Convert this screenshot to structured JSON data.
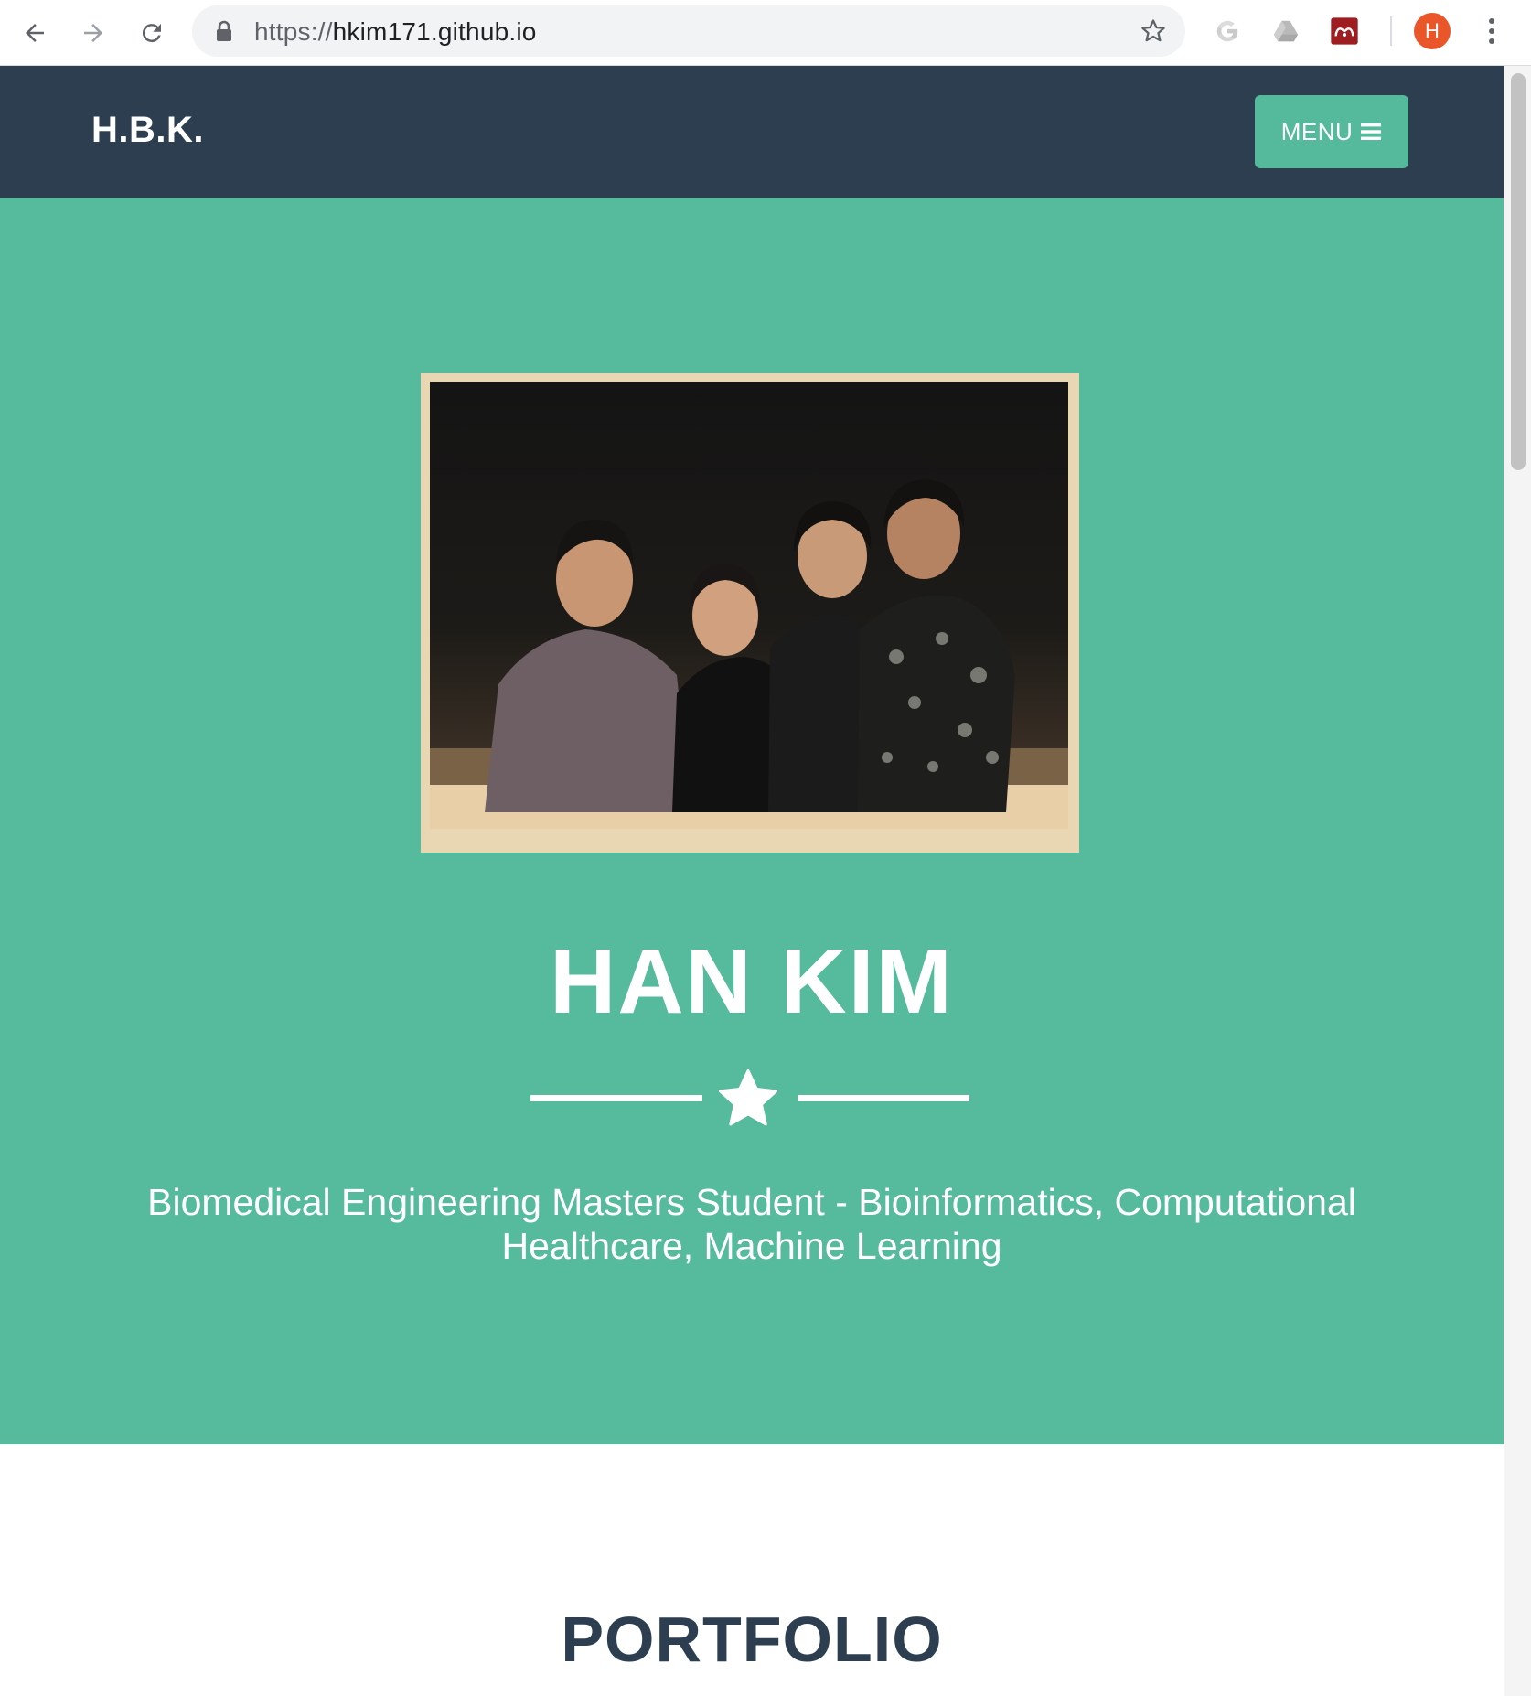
{
  "browser": {
    "url_scheme": "https://",
    "url_host": "hkim171.github.io",
    "profile_initial": "H"
  },
  "icons": {
    "back": "arrow-left-icon",
    "forward": "arrow-right-icon",
    "reload": "reload-icon",
    "lock": "lock-icon",
    "bookmark": "star-outline-icon",
    "ext1": "google-g-icon",
    "ext2": "drive-icon",
    "ext3": "mendeley-icon",
    "menu": "hamburger-icon",
    "divider": "star-icon",
    "more": "kebab-icon"
  },
  "nav": {
    "brand": "H.B.K.",
    "menu_label": "MENU"
  },
  "hero": {
    "name": "HAN KIM",
    "subtitle_line1": "Biomedical Engineering Masters Student - Bioinformatics, Computational",
    "subtitle_line2": "Healthcare, Machine Learning"
  },
  "portfolio": {
    "title": "PORTFOLIO"
  },
  "colors": {
    "navbar": "#2c3e50",
    "hero": "#56ba9c",
    "accent": "#55b99c",
    "profile": "#e8562a"
  }
}
